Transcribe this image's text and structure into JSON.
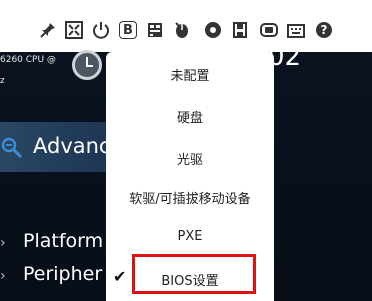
{
  "toolbar": {
    "icons": [
      "pin-icon",
      "fullscreen-icon",
      "power-icon",
      "bios-b-icon",
      "keyboard-lock-icon",
      "mouse-icon",
      "record-icon",
      "save-icon",
      "camera-icon",
      "keyboard-icon",
      "help-icon"
    ],
    "bios_button_label": "B",
    "help_label": "?"
  },
  "left_panel": {
    "cpu_line_1": "6260 CPU @",
    "cpu_line_2": "z",
    "time_fragment": "02",
    "section_title": "Advanc",
    "items": [
      {
        "label": "Platform"
      },
      {
        "label": "Peripher"
      }
    ]
  },
  "menu": {
    "items": [
      {
        "label": "未配置"
      },
      {
        "label": "硬盘"
      },
      {
        "label": "光驱"
      },
      {
        "label": "软驱/可插拔移动设备"
      },
      {
        "label": "PXE"
      },
      {
        "label": "BIOS设置",
        "selected": true
      }
    ],
    "check_mark": "✔"
  },
  "colors": {
    "background": "#07101c",
    "menu_background": "#ffffff",
    "highlight_border": "#e01010",
    "section_band": "#2b4764"
  }
}
